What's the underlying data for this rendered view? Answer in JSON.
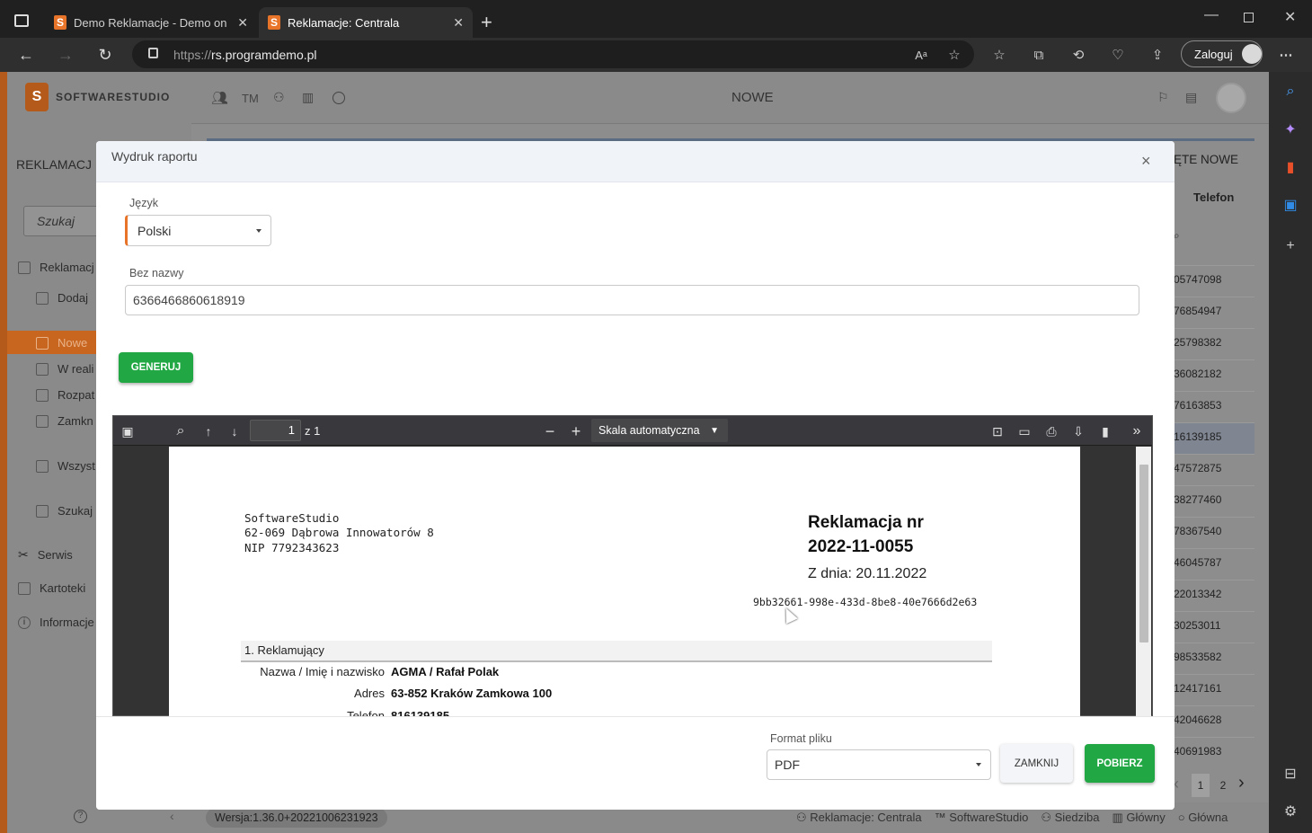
{
  "browser": {
    "tabs": [
      {
        "title": "Demo Reklamacje - Demo on lin"
      },
      {
        "title": "Reklamacje: Centrala"
      }
    ],
    "url_prefix": "https://",
    "url_host": "rs.programdemo.pl",
    "login_label": "Zaloguj"
  },
  "app": {
    "logo_text": "SOFTWARESTUDIO",
    "header_tm": "TM",
    "header_title": "NOWE",
    "sidebar_title": "REKLAMACJ",
    "search_placeholder": "Szukaj",
    "sidebar": [
      {
        "label": "Reklamacj"
      },
      {
        "label": "Dodaj"
      },
      {
        "label": "Nowe"
      },
      {
        "label": "W reali"
      },
      {
        "label": "Rozpat"
      },
      {
        "label": "Zamkn"
      },
      {
        "label": "Wszyst"
      },
      {
        "label": "Szukaj"
      },
      {
        "label": "Serwis"
      },
      {
        "label": "Kartoteki"
      },
      {
        "label": "Informacje"
      }
    ],
    "right_tab_label": "ĘTE NOWE",
    "phone_header": "Telefon",
    "phones": [
      "05747098",
      "76854947",
      "25798382",
      "36082182",
      "76163853",
      "16139185",
      "47572875",
      "38277460",
      "78367540",
      "46045787",
      "22013342",
      "30253011",
      "98533582",
      "12417161",
      "42046628",
      "40691983"
    ],
    "pagination": [
      "1",
      "2"
    ],
    "version": "Wersja:1.36.0+20221006231923",
    "status": [
      {
        "label": "Reklamacje: Centrala"
      },
      {
        "label": "SoftwareStudio"
      },
      {
        "label": "Siedziba"
      },
      {
        "label": "Główny"
      },
      {
        "label": "Główna"
      }
    ]
  },
  "modal": {
    "title": "Wydruk raportu",
    "close": "×",
    "language_label": "Język",
    "language_value": "Polski",
    "name_label": "Bez nazwy",
    "name_value": "6366466860618919",
    "generate_label": "GENERUJ",
    "format_label": "Format pliku",
    "format_value": "PDF",
    "close_label": "ZAMKNIJ",
    "download_label": "POBIERZ"
  },
  "pdf_viewer": {
    "page_number": "1",
    "page_count": "z 1",
    "zoom": "Skala automatyczna"
  },
  "pdf": {
    "company_name": "SoftwareStudio",
    "company_address": "62-069 Dąbrowa Innowatorów 8",
    "company_nip": "NIP 7792343623",
    "heading_line1": "Reklamacja nr",
    "heading_line2": "2022-11-0055",
    "date": "Z dnia: 20.11.2022",
    "uuid": "9bb32661-998e-433d-8be8-40e7666d2e63",
    "section_title": "1. Reklamujący",
    "fields": [
      {
        "label": "Nazwa / Imię i nazwisko",
        "value": "AGMA / Rafał Polak"
      },
      {
        "label": "Adres",
        "value": "63-852 Kraków Zamkowa 100"
      },
      {
        "label": "Telefon",
        "value": "816139185"
      }
    ]
  }
}
